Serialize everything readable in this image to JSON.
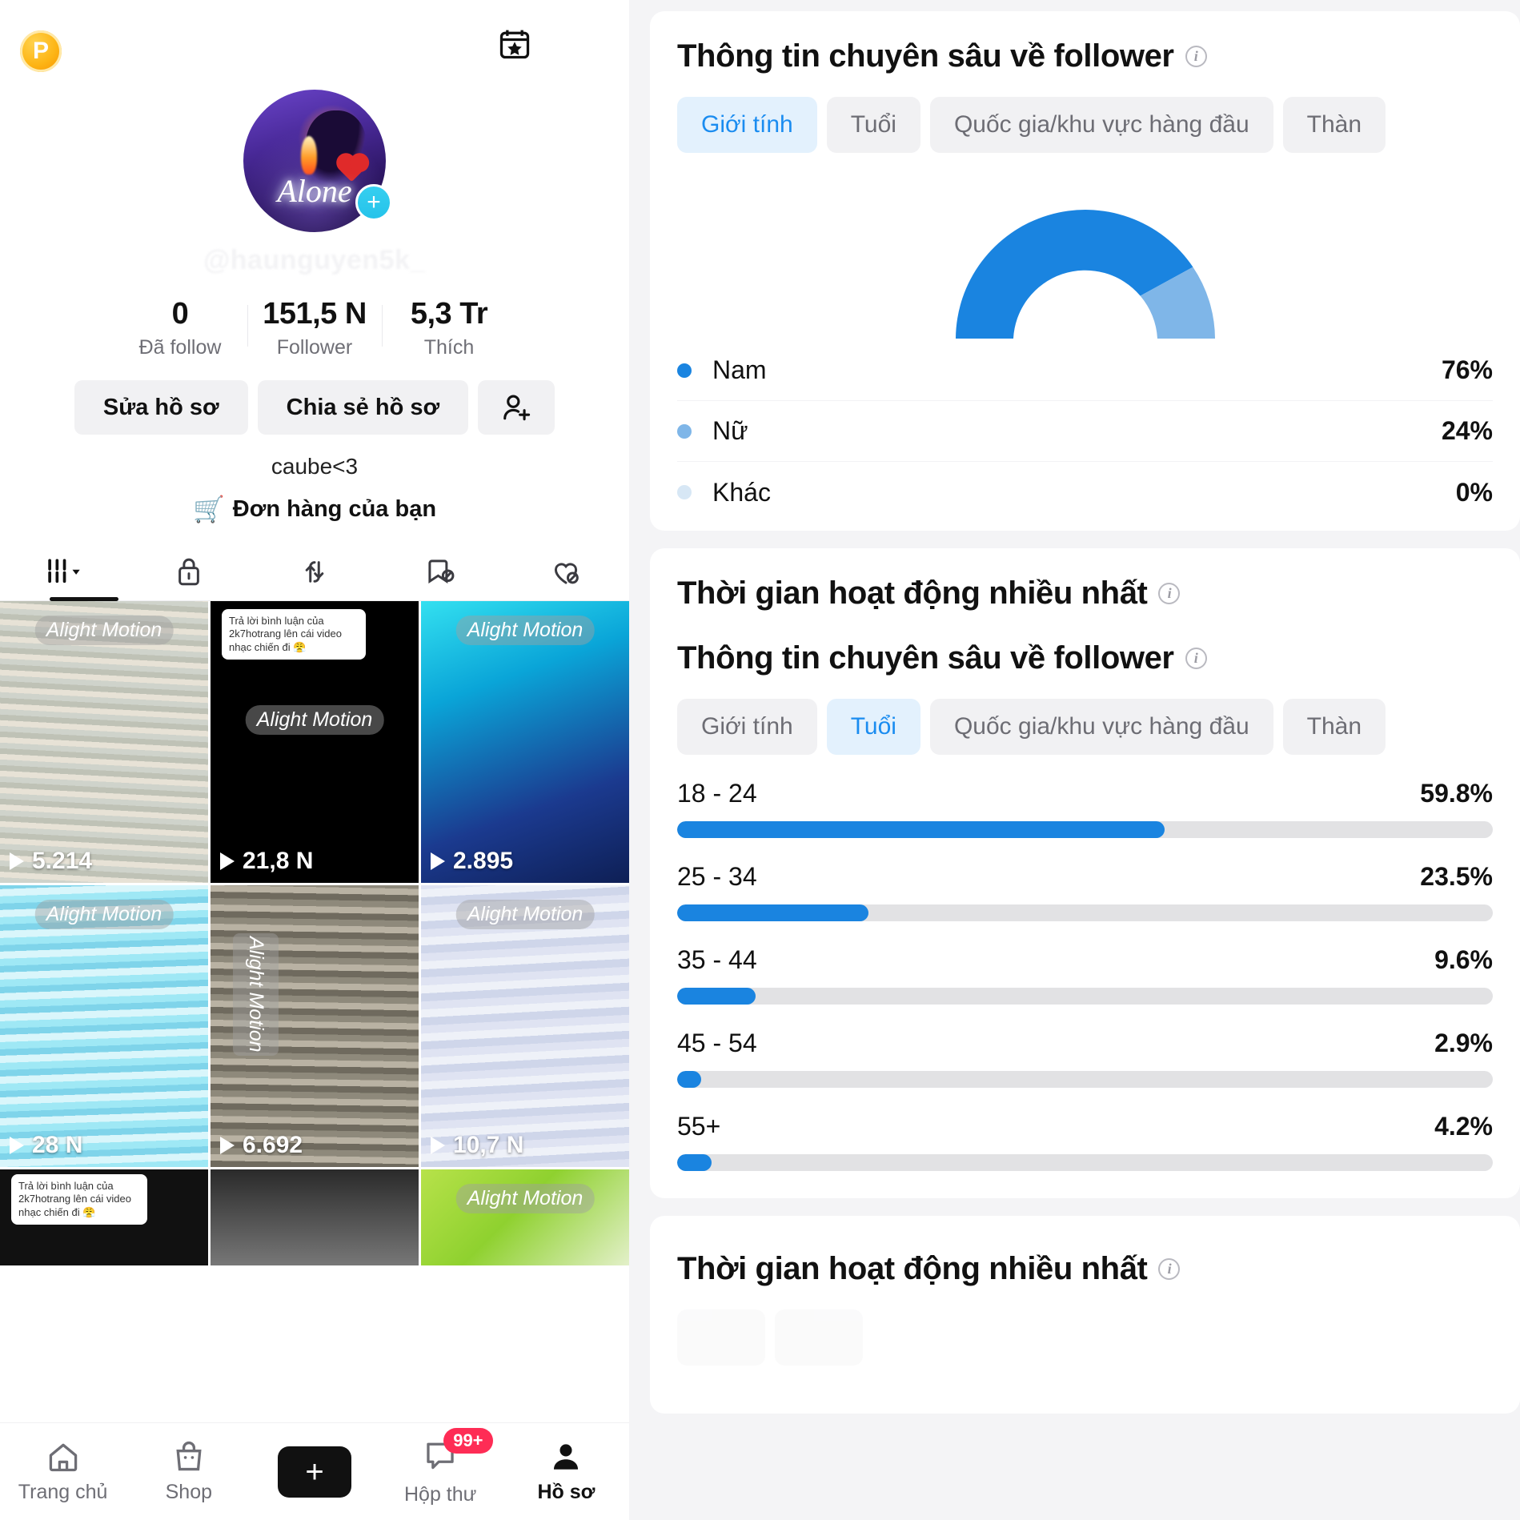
{
  "phone": {
    "coin_badge": "P",
    "icons": {
      "calendar_star": "calendar-star-icon",
      "menu": "hamburger-menu-icon"
    },
    "avatar": {
      "overlay_word": "Alone",
      "add_label": "+"
    },
    "handle": "@haunguyen5k_",
    "stats": [
      {
        "num": "0",
        "label": "Đã follow"
      },
      {
        "num": "151,5 N",
        "label": "Follower"
      },
      {
        "num": "5,3 Tr",
        "label": "Thích"
      }
    ],
    "actions": {
      "edit_profile": "Sửa hồ sơ",
      "share_profile": "Chia sẻ hồ sơ",
      "add_friend_icon": "add-person-icon"
    },
    "bio": "caube<3",
    "orders_label": "Đơn hàng của bạn",
    "tabs": [
      {
        "name": "posts",
        "icon": "grid-icon",
        "active": true
      },
      {
        "name": "private",
        "icon": "lock-icon",
        "active": false
      },
      {
        "name": "reposts",
        "icon": "repost-arrows-icon",
        "active": false
      },
      {
        "name": "saved",
        "icon": "bookmark-hidden-icon",
        "active": false
      },
      {
        "name": "liked",
        "icon": "heart-hidden-icon",
        "active": false
      }
    ],
    "videos": [
      {
        "views": "5.214",
        "watermark": "Alight Motion"
      },
      {
        "views": "21,8 N",
        "watermark": "Alight Motion",
        "sticker": "Trả lời bình luận của 2k7hotrang\nlên cái video nhạc chiến đi 😤"
      },
      {
        "views": "2.895",
        "watermark": "Alight Motion"
      },
      {
        "views": "28 N",
        "watermark": "Alight Motion"
      },
      {
        "views": "6.692",
        "watermark": "Alight Motion"
      },
      {
        "views": "10,7 N",
        "watermark": "Alight Motion"
      },
      {
        "views": "",
        "watermark": ""
      },
      {
        "views": "",
        "watermark": ""
      },
      {
        "views": "",
        "watermark": "Alight Motion"
      }
    ],
    "nav": [
      {
        "label": "Trang chủ",
        "icon": "home-icon",
        "active": false,
        "badge": ""
      },
      {
        "label": "Shop",
        "icon": "shopping-bag-icon",
        "active": false,
        "badge": ""
      },
      {
        "label": "",
        "icon": "plus-create-icon",
        "active": false,
        "badge": ""
      },
      {
        "label": "Hộp thư",
        "icon": "inbox-message-icon",
        "active": false,
        "badge": "99+"
      },
      {
        "label": "Hồ sơ",
        "icon": "person-icon",
        "active": true,
        "badge": ""
      }
    ]
  },
  "analytics": {
    "colors": {
      "primary_blue": "#1a84e0",
      "secondary_blue": "#7fb6e8",
      "tertiary_blue": "#d7e7f5",
      "track_grey": "#e2e2e4",
      "chip_active_bg": "#e3f1fd",
      "chip_active_text": "#1a8cf0"
    },
    "card_gender": {
      "title": "Thông tin chuyên sâu về follower",
      "info_icon": "info-icon",
      "chips": [
        {
          "label": "Giới tính",
          "active": true
        },
        {
          "label": "Tuổi",
          "active": false
        },
        {
          "label": "Quốc gia/khu vực hàng đầu",
          "active": false
        },
        {
          "label": "Thàn",
          "active": false
        }
      ]
    },
    "card_activity_1": {
      "title": "Thời gian hoạt động nhiều nhất",
      "info_icon": "info-icon"
    },
    "card_age": {
      "title": "Thông tin chuyên sâu về follower",
      "info_icon": "info-icon",
      "chips": [
        {
          "label": "Giới tính",
          "active": false
        },
        {
          "label": "Tuổi",
          "active": true
        },
        {
          "label": "Quốc gia/khu vực hàng đầu",
          "active": false
        },
        {
          "label": "Thàn",
          "active": false
        }
      ]
    },
    "card_activity_2": {
      "title": "Thời gian hoạt động nhiều nhất",
      "info_icon": "info-icon"
    }
  },
  "chart_data": [
    {
      "type": "pie",
      "title": "Giới tính",
      "subtitle": "Thông tin chuyên sâu về follower",
      "categories": [
        "Nam",
        "Nữ",
        "Khác"
      ],
      "values": [
        76,
        24,
        0
      ],
      "labels": [
        "76%",
        "24%",
        "0%"
      ],
      "colors": [
        "#1a84e0",
        "#7fb6e8",
        "#d7e7f5"
      ],
      "legend_position": "bottom",
      "notes": "Half-donut gauge, semicircle spanning 180 degrees"
    },
    {
      "type": "bar",
      "title": "Tuổi",
      "subtitle": "Thông tin chuyên sâu về follower",
      "orientation": "horizontal",
      "categories": [
        "18 - 24",
        "25 - 34",
        "35 - 44",
        "45 - 54",
        "55+"
      ],
      "values": [
        59.8,
        23.5,
        9.6,
        2.9,
        4.2
      ],
      "labels": [
        "59.8%",
        "23.5%",
        "9.6%",
        "2.9%",
        "4.2%"
      ],
      "xlabel": "",
      "ylabel": "",
      "xlim": [
        0,
        100
      ],
      "grid": false,
      "bar_color": "#1a84e0",
      "track_color": "#e2e2e4"
    }
  ]
}
